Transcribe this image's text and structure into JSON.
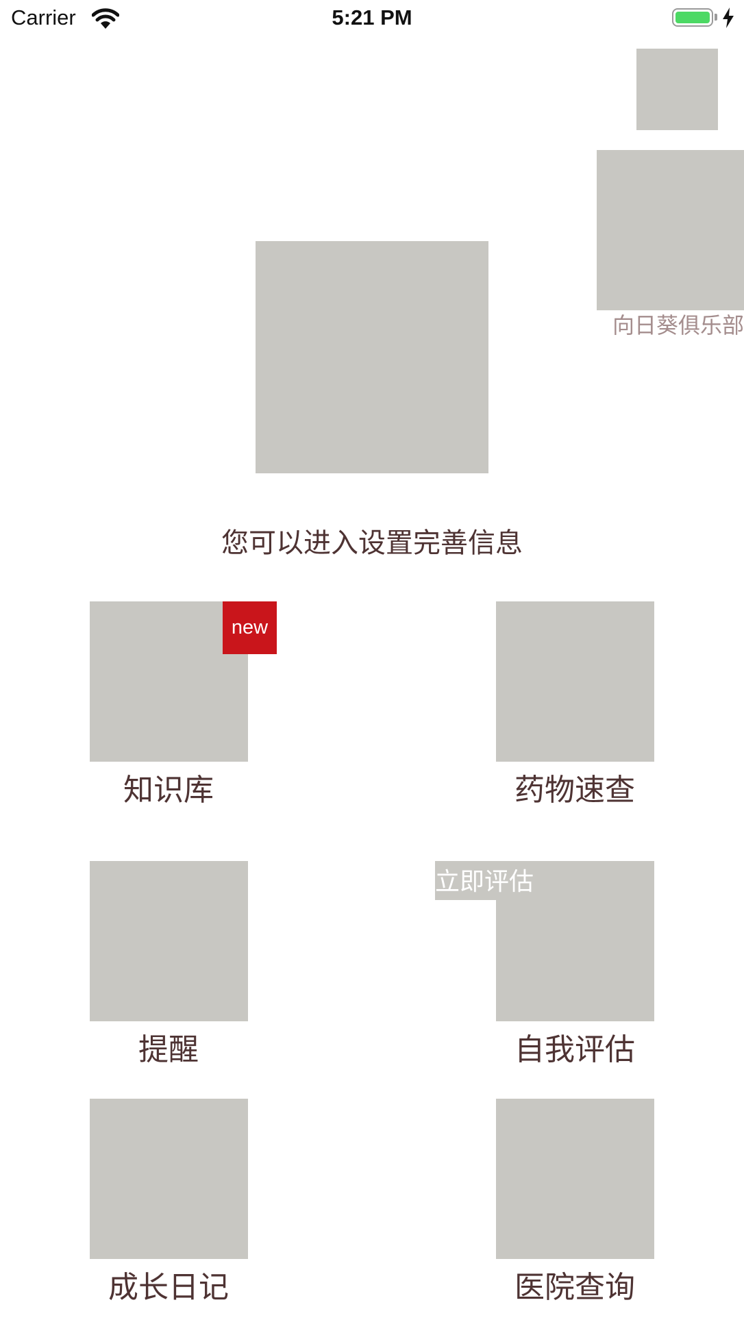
{
  "status_bar": {
    "carrier": "Carrier",
    "time": "5:21 PM",
    "wifi_icon": "wifi-icon",
    "battery_icon": "battery-icon",
    "charging_icon": "lightning-bolt-icon",
    "battery_color": "#4cd964"
  },
  "header": {
    "club_label": "向日葵俱乐部",
    "hint": "您可以进入设置完善信息"
  },
  "grid": {
    "badge_new": "new",
    "assess_overlay": "立即评估",
    "items": [
      {
        "label": "知识库"
      },
      {
        "label": "药物速查"
      },
      {
        "label": "提醒"
      },
      {
        "label": "自我评估"
      },
      {
        "label": "成长日记"
      },
      {
        "label": "医院查询"
      }
    ]
  },
  "colors": {
    "placeholder": "#c8c7c2",
    "text": "#4e3333",
    "club_label": "#a48d8d",
    "badge": "#c9151b"
  }
}
